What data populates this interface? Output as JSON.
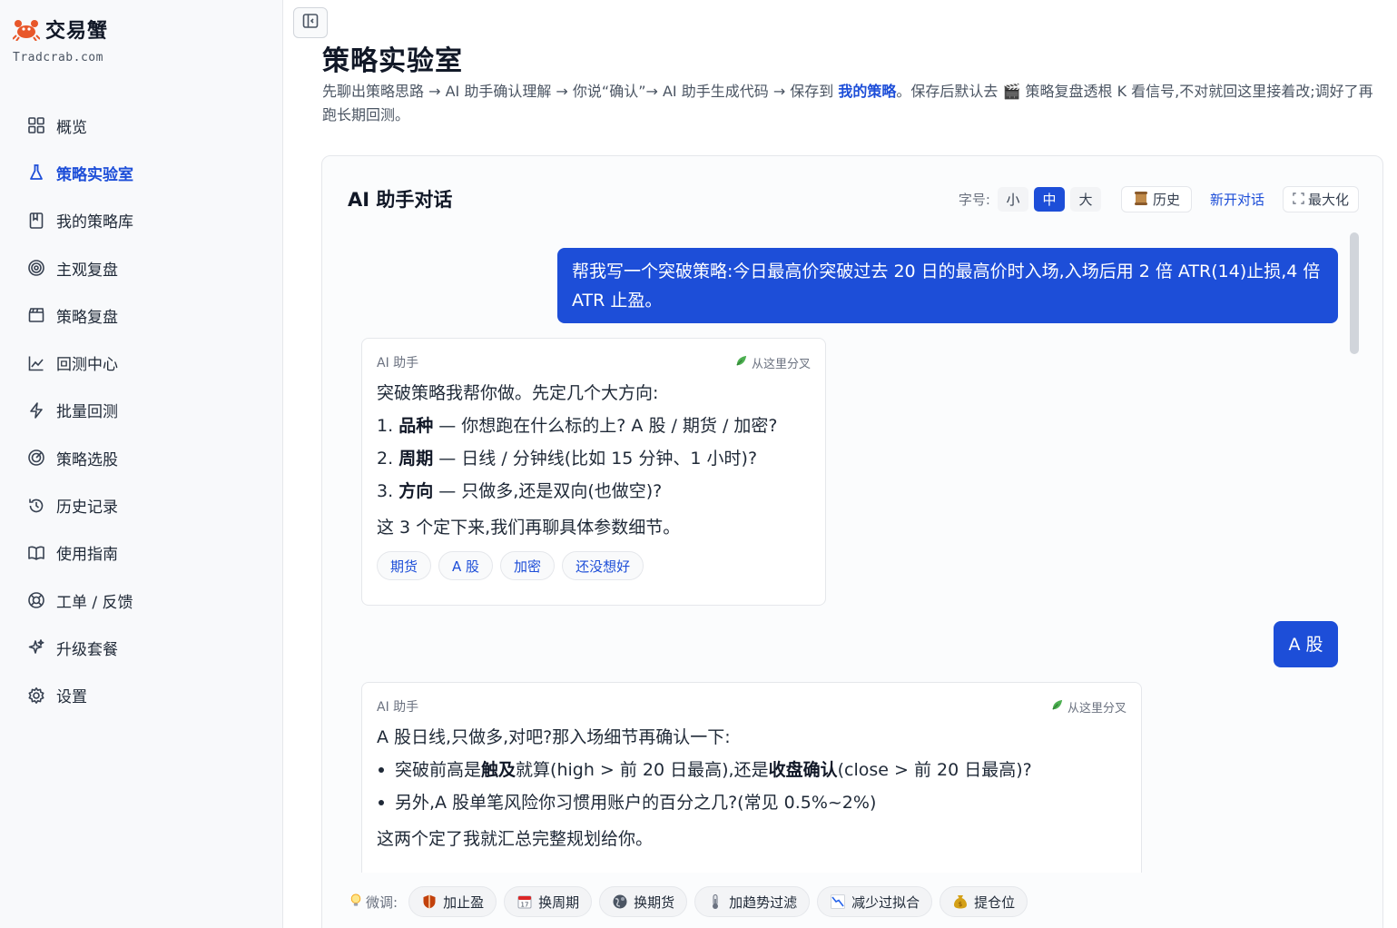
{
  "brand": {
    "name": "交易蟹",
    "url": "Tradcrab.com"
  },
  "nav": [
    {
      "label": "概览",
      "icon": "grid-icon"
    },
    {
      "label": "策略实验室",
      "icon": "flask-icon",
      "active": true
    },
    {
      "label": "我的策略库",
      "icon": "bookmark-icon"
    },
    {
      "label": "主观复盘",
      "icon": "target-icon"
    },
    {
      "label": "策略复盘",
      "icon": "clapperboard-icon"
    },
    {
      "label": "回测中心",
      "icon": "line-chart-icon"
    },
    {
      "label": "批量回测",
      "icon": "lightning-icon"
    },
    {
      "label": "策略选股",
      "icon": "radar-icon"
    },
    {
      "label": "历史记录",
      "icon": "history-icon"
    },
    {
      "label": "使用指南",
      "icon": "book-icon"
    },
    {
      "label": "工单 / 反馈",
      "icon": "lifebuoy-icon"
    },
    {
      "label": "升级套餐",
      "icon": "sparkle-icon"
    },
    {
      "label": "设置",
      "icon": "gear-icon"
    }
  ],
  "page": {
    "title": "策略实验室",
    "desc_before": "先聊出策略思路 → AI 助手确认理解 → 你说“确认”→ AI 助手生成代码 → 保存到 ",
    "desc_link": "我的策略",
    "desc_after": "。保存后默认去 🎬 策略复盘透根 K 看信号,不对就回这里接着改;调好了再跑长期回测。"
  },
  "chat": {
    "title": "AI 助手对话",
    "font_label": "字号:",
    "font_sizes": [
      "小",
      "中",
      "大"
    ],
    "font_selected": "中",
    "history_label": "历史",
    "new_chat_label": "新开对话",
    "maximize_label": "最大化",
    "messages": {
      "user1": "帮我写一个突破策略:今日最高价突破过去 20 日的最高价时入场,入场后用 2 倍 ATR(14)止损,4 倍 ATR 止盈。",
      "ai1": {
        "sender": "AI 助手",
        "fork": "从这里分叉",
        "intro": "突破策略我帮你做。先定几个大方向:",
        "items": [
          {
            "num": "1.",
            "bold": "品种",
            "text": " — 你想跑在什么标的上? A 股 / 期货 / 加密?"
          },
          {
            "num": "2.",
            "bold": "周期",
            "text": " — 日线 / 分钟线(比如 15 分钟、1 小时)?"
          },
          {
            "num": "3.",
            "bold": "方向",
            "text": " — 只做多,还是双向(也做空)?"
          }
        ],
        "outro": "这 3 个定下来,我们再聊具体参数细节。",
        "chips": [
          "期货",
          "A 股",
          "加密",
          "还没想好"
        ]
      },
      "user2": "A 股",
      "ai2": {
        "sender": "AI 助手",
        "fork": "从这里分叉",
        "intro": "A 股日线,只做多,对吧?那入场细节再确认一下:",
        "bullet1": {
          "pre": "突破前高是",
          "b1": "触及",
          "mid": "就算(high > 前 20 日最高),还是",
          "b2": "收盘确认",
          "post": "(close > 前 20 日最高)?"
        },
        "bullet2": "另外,A 股单笔风险你习惯用账户的百分之几?(常见 0.5%~2%)",
        "outro": "这两个定了我就汇总完整规划给你。"
      }
    },
    "finetune": {
      "label": "微调:",
      "buttons": [
        {
          "label": "加止盈",
          "icon": "shield-icon"
        },
        {
          "label": "换周期",
          "icon": "calendar-icon"
        },
        {
          "label": "换期货",
          "icon": "globe-icon"
        },
        {
          "label": "加趋势过滤",
          "icon": "thermometer-icon"
        },
        {
          "label": "减少过拟合",
          "icon": "trend-down-icon"
        },
        {
          "label": "提仓位",
          "icon": "money-bag-icon"
        }
      ]
    }
  },
  "colors": {
    "accent": "#1d4ed8",
    "sidebar_bg": "#f8f9fb",
    "text": "#111827",
    "muted": "#6b7280"
  }
}
